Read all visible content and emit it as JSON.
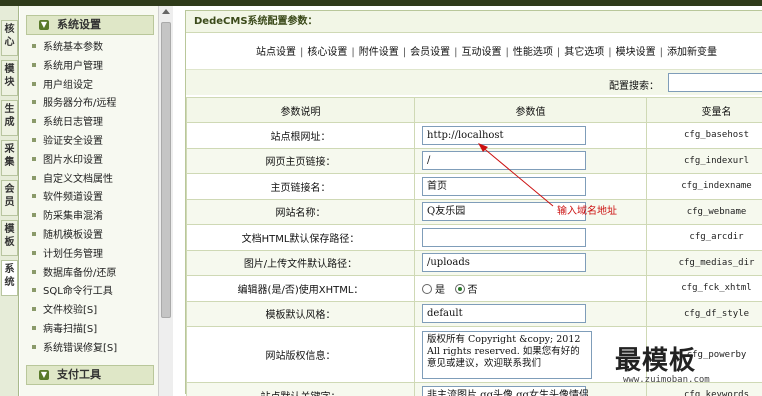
{
  "vtabs": [
    {
      "label": "核心",
      "active": false
    },
    {
      "label": "模块",
      "active": false
    },
    {
      "label": "生成",
      "active": false
    },
    {
      "label": "采集",
      "active": false
    },
    {
      "label": "会员",
      "active": false
    },
    {
      "label": "模板",
      "active": false
    },
    {
      "label": "系统",
      "active": true
    }
  ],
  "sidebar": {
    "section1": "系统设置",
    "items": [
      "系统基本参数",
      "系统用户管理",
      "用户组设定",
      "服务器分布/远程",
      "系统日志管理",
      "验证安全设置",
      "图片水印设置",
      "自定义文档属性",
      "软件频道设置",
      "防采集串混淆",
      "随机模板设置",
      "计划任务管理",
      "数据库备份/还原",
      "SQL命令行工具",
      "文件校验[S]",
      "病毒扫描[S]",
      "系统错误修复[S]"
    ],
    "section2": "支付工具"
  },
  "main": {
    "title": "DedeCMS系统配置参数：",
    "tabs": [
      "站点设置",
      "核心设置",
      "附件设置",
      "会员设置",
      "互动设置",
      "性能选项",
      "其它选项",
      "模块设置",
      "添加新变量"
    ],
    "search_label": "配置搜索：",
    "columns": [
      "参数说明",
      "参数值",
      "变量名"
    ],
    "rows": [
      {
        "label": "站点根网址：",
        "type": "input",
        "value": "http://localhost",
        "var": "cfg_basehost"
      },
      {
        "label": "网页主页链接：",
        "type": "input",
        "value": "/",
        "var": "cfg_indexurl"
      },
      {
        "label": "主页链接名：",
        "type": "input",
        "value": "首页",
        "var": "cfg_indexname"
      },
      {
        "label": "网站名称：",
        "type": "input",
        "value": "Q友乐园",
        "var": "cfg_webname"
      },
      {
        "label": "文档HTML默认保存路径：",
        "type": "input",
        "value": "",
        "var": "cfg_arcdir"
      },
      {
        "label": "图片/上传文件默认路径：",
        "type": "input",
        "value": "/uploads",
        "var": "cfg_medias_dir"
      },
      {
        "label": "编辑器(是/否)使用XHTML：",
        "type": "radio",
        "yes": "是",
        "no": "否",
        "var": "cfg_fck_xhtml"
      },
      {
        "label": "模板默认风格：",
        "type": "input",
        "value": "default",
        "var": "cfg_df_style"
      },
      {
        "label": "网站版权信息：",
        "type": "textarea",
        "value": "版权所有 Copyright &copy; 2012 All rights reserved. 如果您有好的意见或建议，欢迎联系我们",
        "var": "cfg_powerby"
      },
      {
        "label": "站点默认关键字：",
        "type": "input",
        "value": "非主流图片,qq头像,qq女生头像情侣",
        "var": "cfg_keywords"
      }
    ],
    "annotation": "输入域名地址"
  },
  "watermark": {
    "title": "最模板",
    "url": "www.zuimoban.com"
  }
}
